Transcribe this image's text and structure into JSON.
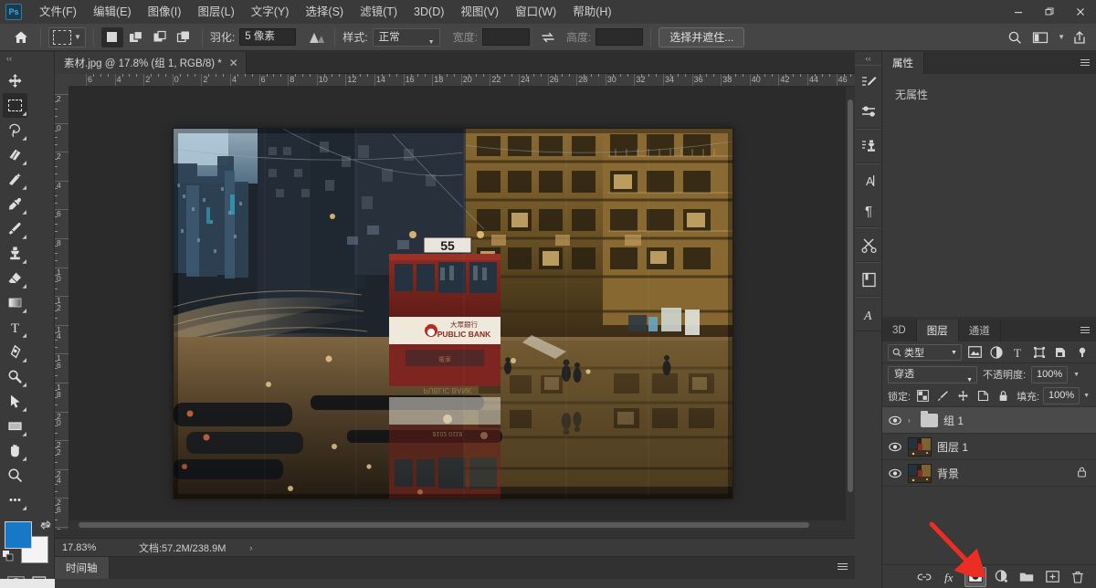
{
  "app": {
    "logo": "Ps",
    "title": "Adobe Photoshop"
  },
  "menubar": {
    "items": [
      {
        "label": "文件(F)",
        "name": "menu-file"
      },
      {
        "label": "编辑(E)",
        "name": "menu-edit"
      },
      {
        "label": "图像(I)",
        "name": "menu-image"
      },
      {
        "label": "图层(L)",
        "name": "menu-layer"
      },
      {
        "label": "文字(Y)",
        "name": "menu-type"
      },
      {
        "label": "选择(S)",
        "name": "menu-select"
      },
      {
        "label": "滤镜(T)",
        "name": "menu-filter"
      },
      {
        "label": "3D(D)",
        "name": "menu-3d"
      },
      {
        "label": "视图(V)",
        "name": "menu-view"
      },
      {
        "label": "窗口(W)",
        "name": "menu-window"
      },
      {
        "label": "帮助(H)",
        "name": "menu-help"
      }
    ],
    "window_controls": {
      "minimize": "—",
      "maximize": "❐",
      "close": "✕"
    }
  },
  "options_bar": {
    "home_icon": "home-icon",
    "tool_preset": "rectangular-marquee-tool",
    "bool_modes": [
      "new-selection",
      "add-to-selection",
      "subtract-from-selection",
      "intersect-selection"
    ],
    "feather_label": "羽化:",
    "feather_value": "5 像素",
    "antialias_icon": "anti-alias-icon",
    "style_label": "样式:",
    "style_value": "正常",
    "width_label": "宽度:",
    "width_value": "",
    "swap_icon": "swap-width-height-icon",
    "height_label": "高度:",
    "height_value": "",
    "select_and_mask": "选择并遮住...",
    "search_icon": "search-icon",
    "workspace_icon": "workspace-switcher-icon",
    "share_icon": "share-icon"
  },
  "document": {
    "tab_title": "素材.jpg @ 17.8% (组 1, RGB/8) *",
    "close_label": "✕"
  },
  "toolbar": {
    "collapse": "‹‹",
    "tools": [
      {
        "name": "move-tool",
        "glyph": "✥",
        "active": false,
        "flyout": false
      },
      {
        "name": "rectangular-marquee-tool",
        "glyph": "▭",
        "active": true,
        "flyout": true
      },
      {
        "name": "lasso-tool",
        "glyph": "✐",
        "active": false,
        "flyout": true
      },
      {
        "name": "quick-selection-tool",
        "glyph": "❂",
        "active": false,
        "flyout": true
      },
      {
        "name": "crop-tool",
        "glyph": "⌗",
        "active": false,
        "flyout": true
      },
      {
        "name": "eyedropper-tool",
        "glyph": "⚲",
        "active": false,
        "flyout": true
      },
      {
        "name": "brush-tool",
        "glyph": "✎",
        "active": false,
        "flyout": true
      },
      {
        "name": "clone-stamp-tool",
        "glyph": "⚑",
        "active": false,
        "flyout": true
      },
      {
        "name": "eraser-tool",
        "glyph": "◣",
        "active": false,
        "flyout": true
      },
      {
        "name": "gradient-tool",
        "glyph": "▦",
        "active": false,
        "flyout": true
      },
      {
        "name": "type-tool",
        "glyph": "T",
        "active": false,
        "flyout": true
      },
      {
        "name": "pen-tool",
        "glyph": "✒",
        "active": false,
        "flyout": true
      },
      {
        "name": "dodge-tool",
        "glyph": "⌕",
        "active": false,
        "flyout": true
      },
      {
        "name": "path-selection-tool",
        "glyph": "➤",
        "active": false,
        "flyout": true
      },
      {
        "name": "shape-tool",
        "glyph": "▬",
        "active": false,
        "flyout": true
      },
      {
        "name": "hand-tool",
        "glyph": "✋",
        "active": false,
        "flyout": true
      },
      {
        "name": "zoom-tool",
        "glyph": "🔍",
        "active": false,
        "flyout": false
      },
      {
        "name": "edit-toolbar-tool",
        "glyph": "···",
        "active": false,
        "flyout": true
      }
    ],
    "foreground_color": "#1878c8",
    "background_color": "#f4f4f4",
    "swap_icon": "swap-colors-icon",
    "default_colors_icon": "default-colors-icon",
    "quick_mask_icon": "quick-mask-icon",
    "screen_mode_icon": "screen-mode-icon"
  },
  "ruler": {
    "horizontal_labels": [
      "6",
      "4",
      "2",
      "0",
      "2",
      "4",
      "6",
      "8",
      "10",
      "12",
      "14",
      "16",
      "18",
      "20",
      "22",
      "24",
      "26",
      "28",
      "30",
      "32",
      "34",
      "36",
      "38",
      "40",
      "42",
      "44",
      "46"
    ],
    "vertical_labels": [
      "2",
      "0",
      "2",
      "4",
      "6",
      "8",
      "10",
      "12",
      "14",
      "16",
      "18",
      "20",
      "22",
      "24",
      "26",
      "28"
    ],
    "unit": "cm"
  },
  "statusbar": {
    "zoom": "17.83%",
    "doc_info": "文档:57.2M/238.9M",
    "arrow": "›"
  },
  "timeline": {
    "tab_label": "时间轴"
  },
  "right_rail": {
    "collapse": "‹‹",
    "icons": [
      {
        "name": "brush-settings-icon",
        "glyph": "brush-settings"
      },
      {
        "name": "adjustments-icon",
        "glyph": "adjustments"
      },
      {
        "name": "clone-source-icon",
        "glyph": "clone-source"
      },
      {
        "name": "character-panel-icon",
        "glyph": "A"
      },
      {
        "name": "paragraph-panel-icon",
        "glyph": "¶"
      },
      {
        "name": "scissors-icon",
        "glyph": "scissors"
      },
      {
        "name": "libraries-icon",
        "glyph": "library"
      },
      {
        "name": "glyphs-icon",
        "glyph": "𝒜"
      }
    ]
  },
  "properties_panel": {
    "tabs": [
      {
        "label": "属性",
        "active": true
      }
    ],
    "empty_text": "无属性",
    "menu_icon": "panel-menu-icon"
  },
  "layers_panel": {
    "tabs": [
      {
        "label": "3D",
        "active": false
      },
      {
        "label": "图层",
        "active": true
      },
      {
        "label": "通道",
        "active": false
      }
    ],
    "menu_icon": "panel-menu-icon",
    "filter": {
      "search_icon": "search-icon",
      "type_label": "类型",
      "icons": [
        "filter-pixel-icon",
        "filter-adjustment-icon",
        "filter-type-icon",
        "filter-shape-icon",
        "filter-smart-object-icon",
        "filter-toggle-icon"
      ]
    },
    "blend_mode": "穿透",
    "opacity_label": "不透明度:",
    "opacity_value": "100%",
    "lock_label": "锁定:",
    "lock_icons": [
      "lock-transparent-pixels-icon",
      "lock-image-pixels-icon",
      "lock-position-icon",
      "lock-artboard-nesting-icon",
      "lock-all-icon"
    ],
    "fill_label": "填充:",
    "fill_value": "100%",
    "layers": [
      {
        "name": "组 1",
        "type": "group",
        "selected": true,
        "visible": true,
        "locked": false,
        "expander": "›"
      },
      {
        "name": "图层 1",
        "type": "pixel",
        "selected": false,
        "visible": true,
        "locked": false
      },
      {
        "name": "背景",
        "type": "pixel",
        "selected": false,
        "visible": true,
        "locked": true,
        "lock_glyph": "🔒"
      }
    ],
    "bottom_buttons": [
      {
        "name": "link-layers-button",
        "glyph": "link",
        "highlighted": false
      },
      {
        "name": "layer-style-button",
        "glyph": "fx",
        "highlighted": false
      },
      {
        "name": "add-layer-mask-button",
        "glyph": "mask",
        "highlighted": true
      },
      {
        "name": "new-adjustment-layer-button",
        "glyph": "adjustment",
        "highlighted": false
      },
      {
        "name": "new-group-button",
        "glyph": "folder",
        "highlighted": false
      },
      {
        "name": "new-layer-button",
        "glyph": "plus",
        "highlighted": false
      },
      {
        "name": "delete-layer-button",
        "glyph": "trash",
        "highlighted": false
      }
    ]
  },
  "annotation": {
    "arrow_color": "#ec2d24",
    "points_to": "add-layer-mask-button"
  },
  "canvas": {
    "image_description": "香港街景双层电车 55 路 PUBLIC BANK 倒影合成",
    "tram_number": "55",
    "tram_sign": "PUBLIC BANK",
    "tram_sign_cn": "大眾銀行"
  }
}
